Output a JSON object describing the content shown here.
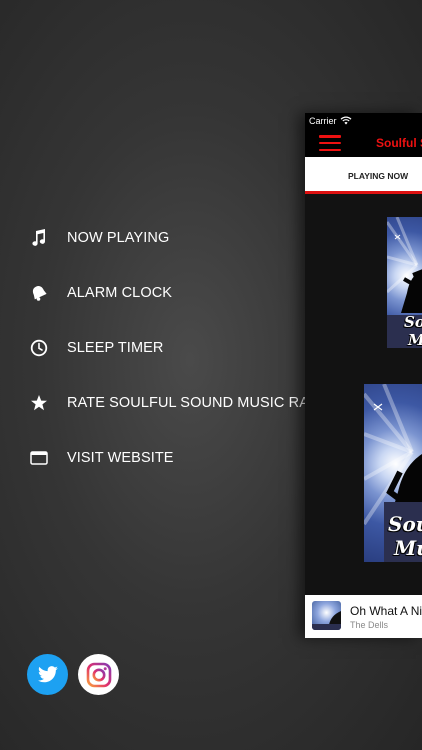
{
  "menu": {
    "items": [
      {
        "label": "NOW PLAYING",
        "icon": "music-note-icon"
      },
      {
        "label": "ALARM CLOCK",
        "icon": "bell-icon"
      },
      {
        "label": "SLEEP TIMER",
        "icon": "clock-icon"
      },
      {
        "label": "RATE SOULFUL SOUND MUSIC RADIO",
        "icon": "star-icon"
      },
      {
        "label": "VISIT WEBSITE",
        "icon": "browser-window-icon"
      }
    ]
  },
  "social": {
    "twitter_icon": "twitter-icon",
    "instagram_icon": "instagram-icon",
    "twitter_color": "#1da1f2"
  },
  "app": {
    "carrier": "Carrier",
    "title": "Soulful Sound Music Radio",
    "tab": "PLAYING NOW",
    "artwork_text_line1": "Soulful",
    "artwork_text_line2": "Music",
    "accent_color": "#e11111"
  },
  "now_playing": {
    "title": "Oh What A Night",
    "artist": "The Dells"
  }
}
